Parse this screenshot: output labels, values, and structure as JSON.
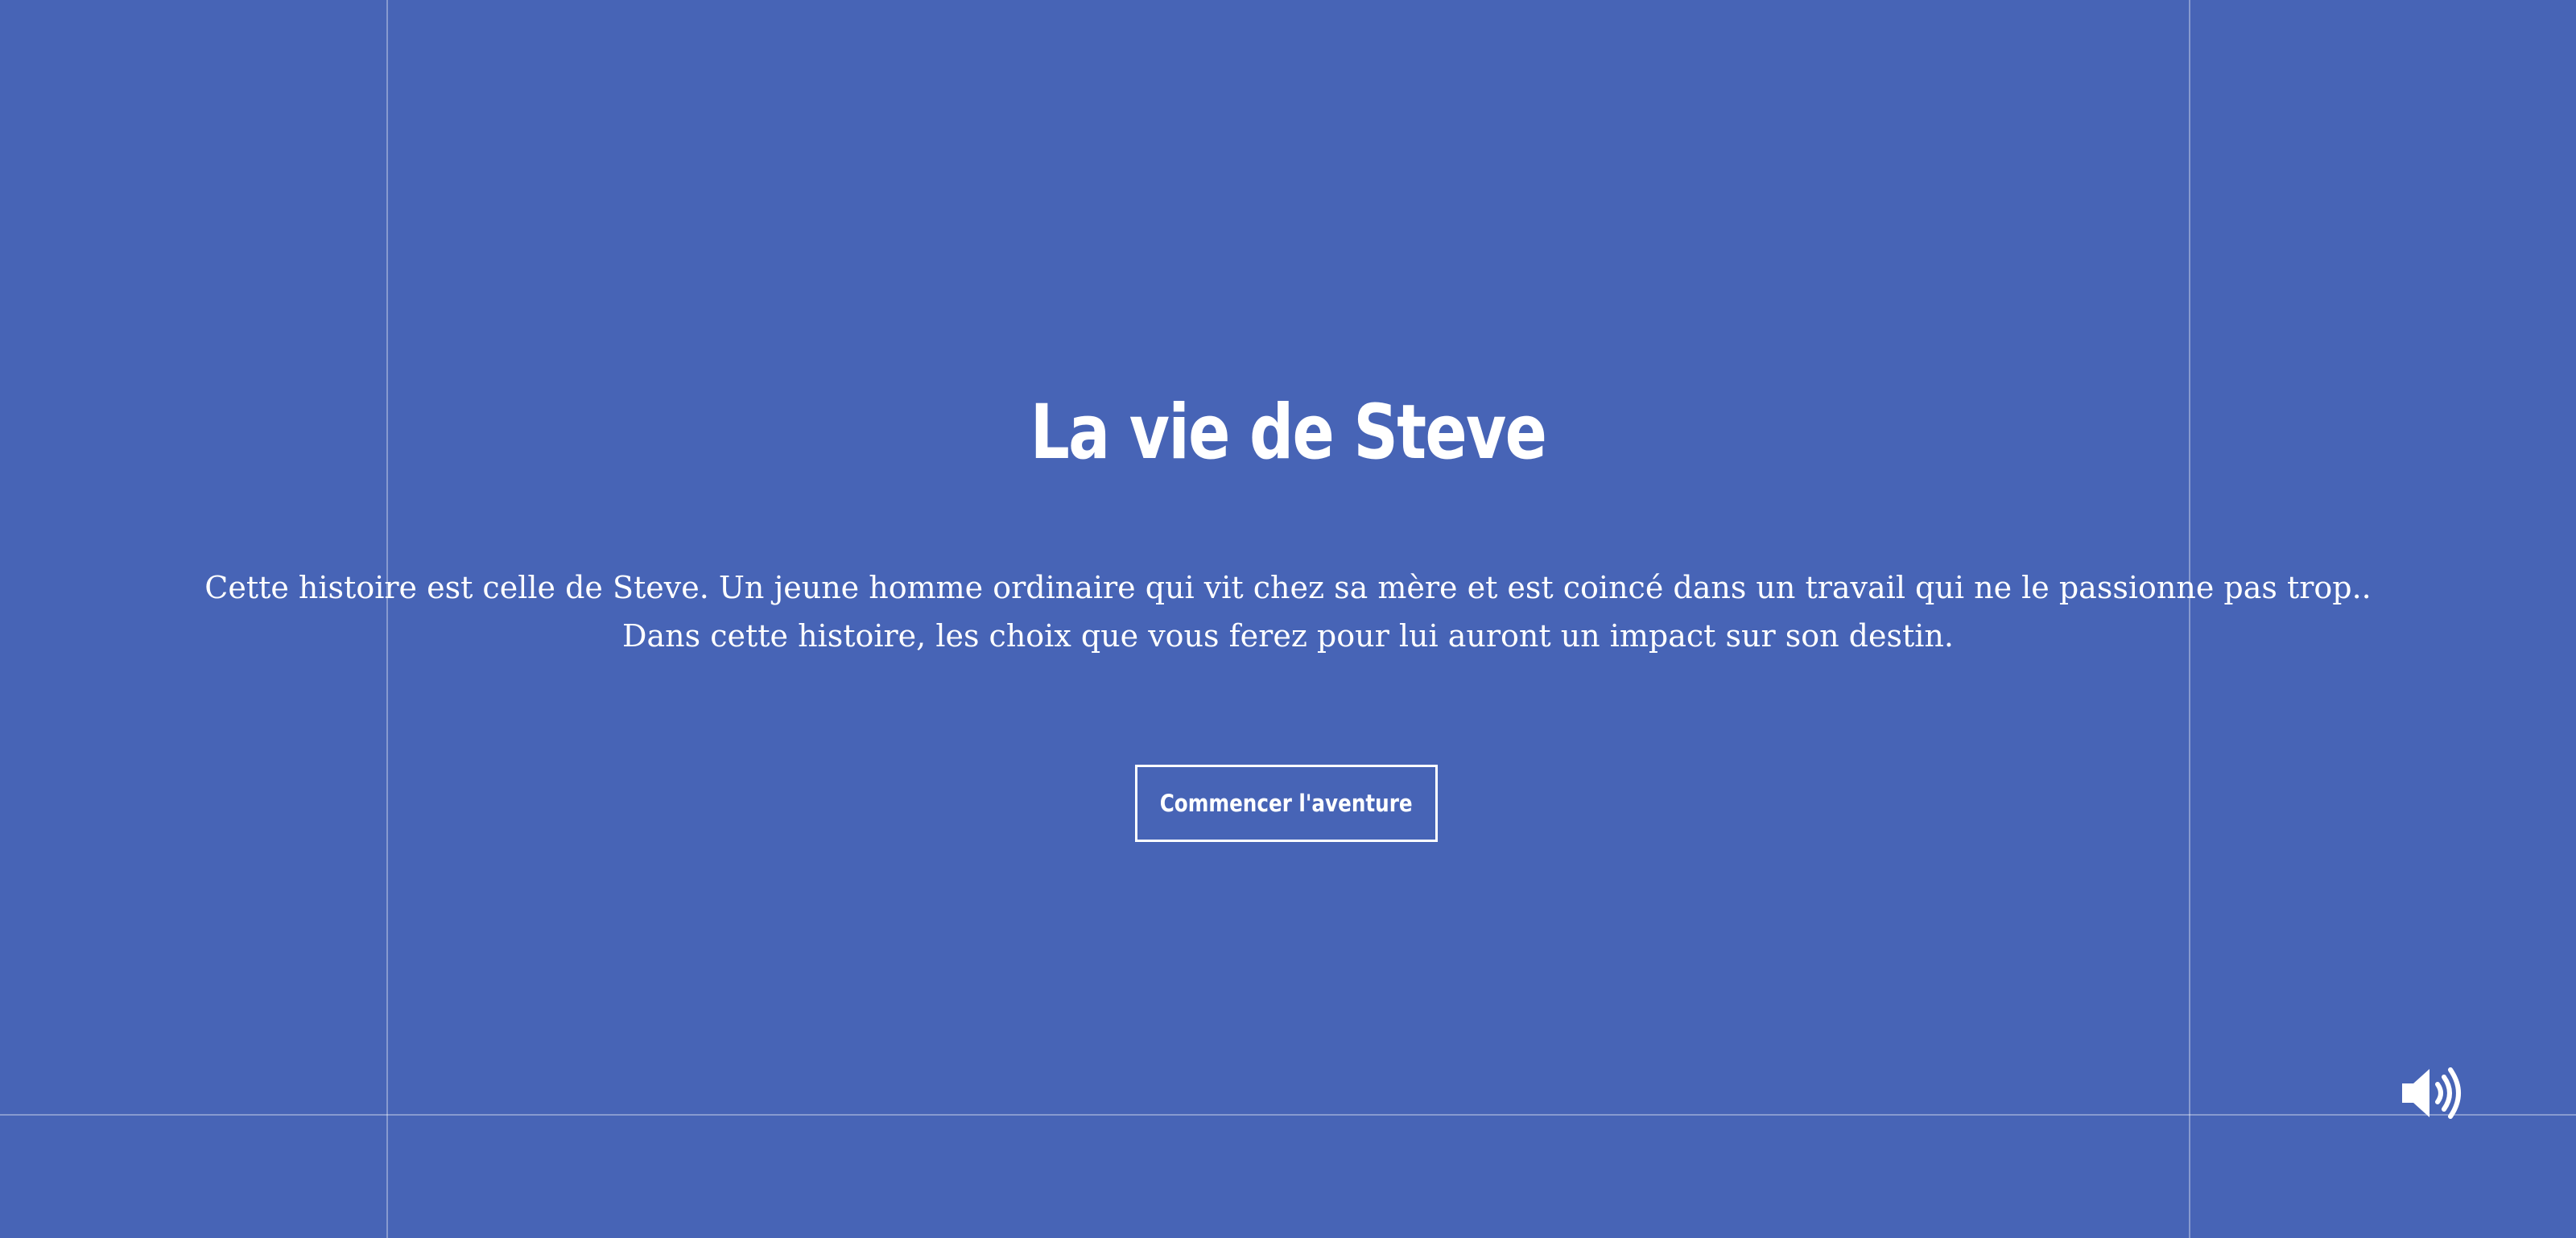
{
  "page": {
    "title": "La vie de Steve",
    "description_lines": [
      "Cette histoire est celle de Steve. Un jeune homme ordinaire qui vit chez sa mère et est coincé dans un travail qui ne le passionne pas trop..",
      "Dans cette histoire, les choix que vous ferez pour lui auront un impact sur son destin."
    ],
    "start_button_label": "Commencer l'aventure"
  },
  "controls": {
    "sound_icon": "volume-up-icon"
  },
  "colors": {
    "background": "#4764b6",
    "text": "#ffffff",
    "guide_lines": "rgba(255,255,255,0.35)"
  }
}
